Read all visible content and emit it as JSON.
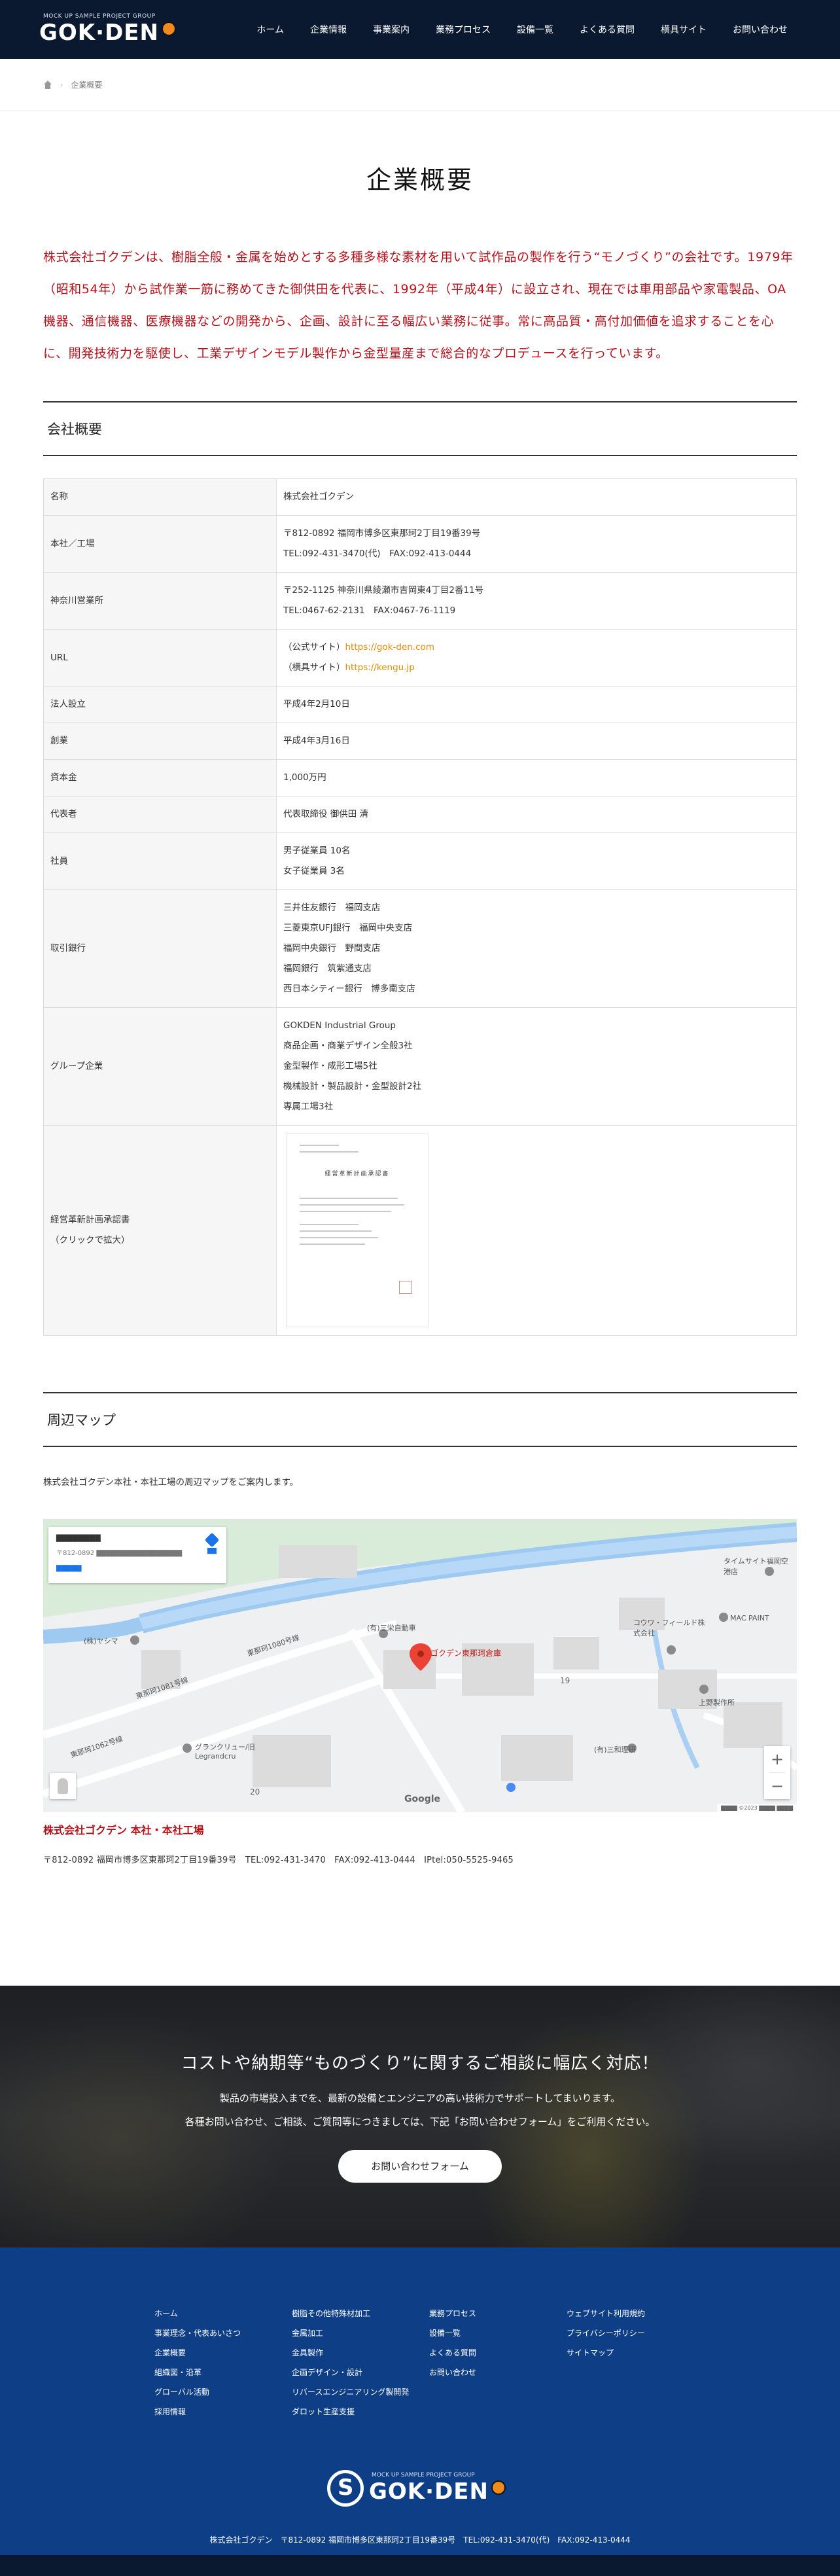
{
  "header": {
    "logo_tag": "MOCK UP SAMPLE PROJECT GROUP",
    "logo_text": "GOK·DEN",
    "nav": [
      "ホーム",
      "企業情報",
      "事業案内",
      "業務プロセス",
      "設備一覧",
      "よくある質問",
      "横具サイト",
      "お問い合わせ"
    ]
  },
  "breadcrumb": {
    "current": "企業概要"
  },
  "page_title": "企業概要",
  "intro": "株式会社ゴクデンは、樹脂全般・金属を始めとする多種多様な素材を用いて試作品の製作を行う“モノづくり”の会社です。1979年（昭和54年）から試作業一筋に務めてきた御供田を代表に、1992年（平成4年）に設立され、現在では車用部品や家電製品、OA機器、通信機器、医療機器などの開発から、企画、設計に至る幅広い業務に従事。常に高品質・高付加価値を追求することを心に、開発技術力を駆使し、工業デザインモデル製作から金型量産まで総合的なプロデュースを行っています。",
  "company": {
    "heading": "会社概要",
    "rows": [
      {
        "label": "名称",
        "lines": [
          "株式会社ゴクデン"
        ]
      },
      {
        "label": "本社／工場",
        "lines": [
          "〒812-0892 福岡市博多区東那珂2丁目19番39号",
          "TEL:092-431-3470(代)　FAX:092-413-0444"
        ]
      },
      {
        "label": "神奈川営業所",
        "lines": [
          "〒252-1125 神奈川県綾瀬市吉岡東4丁目2番11号",
          "TEL:0467-62-2131　FAX:0467-76-1119"
        ]
      },
      {
        "label": "URL",
        "links": [
          {
            "prefix": "（公式サイト）",
            "url": "https://gok-den.com"
          },
          {
            "prefix": "（横具サイト）",
            "url": "https://kengu.jp"
          }
        ]
      },
      {
        "label": "法人設立",
        "lines": [
          "平成4年2月10日"
        ]
      },
      {
        "label": "創業",
        "lines": [
          "平成4年3月16日"
        ]
      },
      {
        "label": "資本金",
        "lines": [
          "1,000万円"
        ]
      },
      {
        "label": "代表者",
        "lines": [
          "代表取締役 御供田 清"
        ]
      },
      {
        "label": "社員",
        "lines": [
          "男子従業員 10名",
          "女子従業員 3名"
        ]
      },
      {
        "label": "取引銀行",
        "lines": [
          "三井住友銀行　福岡支店",
          "三菱東京UFJ銀行　福岡中央支店",
          "福岡中央銀行　野間支店",
          "福岡銀行　筑紫通支店",
          "西日本シティー銀行　博多南支店"
        ]
      },
      {
        "label": "グループ企業",
        "lines": [
          "GOKDEN Industrial Group",
          "商品企画・商業デザイン全般3社",
          "金型製作・成形工場5社",
          "機械設計・製品設計・金型設計2社",
          "専属工場3社"
        ]
      }
    ],
    "cert_label_1": "経営革新計画承認書",
    "cert_label_2": "（クリックで拡大）",
    "cert_doc_title": "経営革新計画承認書"
  },
  "map": {
    "heading": "周辺マップ",
    "lead": "株式会社ゴクデン本社・本社工場の周辺マップをご案内します。",
    "pin_label": "ゴクデン東那珂倉庫",
    "google": "Google",
    "labels": [
      "(有)三栄自動車",
      "(株)ヤシマ",
      "東那珂1080号線",
      "東那珂1081号線",
      "東那珂1062号線",
      "グランクリュー/旧Legrandcru",
      "MAC PAINT",
      "コウワ・フィールド株式会社",
      "上野製作所",
      "(有)三和理研",
      "タイムサイト福岡空港店",
      "19",
      "20"
    ]
  },
  "address": {
    "title": "株式会社ゴクデン 本社・本社工場",
    "line": "〒812-0892 福岡市博多区東那珂2丁目19番39号　TEL:092-431-3470　FAX:092-413-0444　IPtel:050-5525-9465"
  },
  "cta": {
    "title": "コストや納期等“ものづくり”に関するご相談に幅広く対応！",
    "line1": "製品の市場投入までを、最新の設備とエンジニアの高い技術力でサポートしてまいります。",
    "line2": "各種お問い合わせ、ご相談、ご質問等につきましては、下記「お問い合わせフォーム」をご利用ください。",
    "button": "お問い合わせフォーム"
  },
  "footer": {
    "col1": [
      "ホーム",
      "事業理念・代表あいさつ",
      "企業概要",
      "組織図・沿革",
      "グローバル活動",
      "採用情報"
    ],
    "col2": [
      "樹脂その他特殊材加工",
      "金属加工",
      "金具製作",
      "企画デザイン・設計",
      "リバースエンジニアリング製開発",
      "ダロット生産支援"
    ],
    "col3": [
      "業務プロセス",
      "設備一覧",
      "よくある質問",
      "お問い合わせ"
    ],
    "col4": [
      "ウェブサイト利用規約",
      "プライバシーポリシー",
      "サイトマップ"
    ],
    "logo_tag": "MOCK UP SAMPLE PROJECT GROUP",
    "logo_text": "GOK·DEN",
    "address": "株式会社ゴクデン　〒812-0892 福岡市博多区東那珂2丁目19番39号　TEL:092-431-3470(代)　FAX:092-413-0444"
  },
  "colors": {
    "header_bg": "#0a1930",
    "accent_red": "#b5121b",
    "link_orange": "#e48a00",
    "footer_bg": "#0d3e86"
  }
}
